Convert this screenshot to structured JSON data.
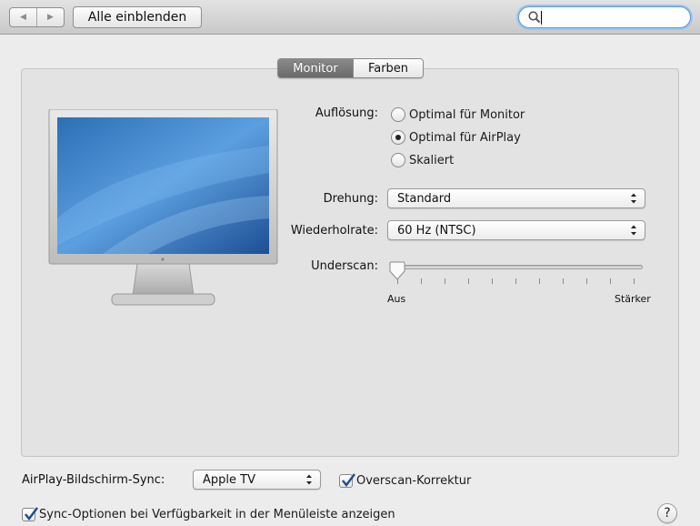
{
  "toolbar": {
    "back_icon": "◀",
    "forward_icon": "▶",
    "show_all_label": "Alle einblenden",
    "search_value": "",
    "search_placeholder": ""
  },
  "tabs": [
    {
      "label": "Monitor",
      "active": true
    },
    {
      "label": "Farben",
      "active": false
    }
  ],
  "resolution": {
    "label": "Auflösung:",
    "options": [
      {
        "label": "Optimal für Monitor",
        "selected": false
      },
      {
        "label": "Optimal für AirPlay",
        "selected": true
      },
      {
        "label": "Skaliert",
        "selected": false
      }
    ]
  },
  "rotation": {
    "label": "Drehung:",
    "value": "Standard"
  },
  "refresh": {
    "label": "Wiederholrate:",
    "value": "60 Hz (NTSC)"
  },
  "underscan": {
    "label": "Underscan:",
    "min_label": "Aus",
    "max_label": "Stärker",
    "value": 0,
    "ticks": 11
  },
  "airplay_sync": {
    "label": "AirPlay-Bildschirm-Sync:",
    "value": "Apple TV"
  },
  "overscan": {
    "label": "Overscan-Korrektur",
    "checked": true
  },
  "menu_sync": {
    "label": "Sync-Optionen bei Verfügbarkeit in der Menüleiste anzeigen",
    "checked": true
  },
  "help_label": "?",
  "colors": {
    "accent": "#3a7bd5",
    "search_focus": "#9cc6f0",
    "active_tab": "#7a7a7a"
  }
}
